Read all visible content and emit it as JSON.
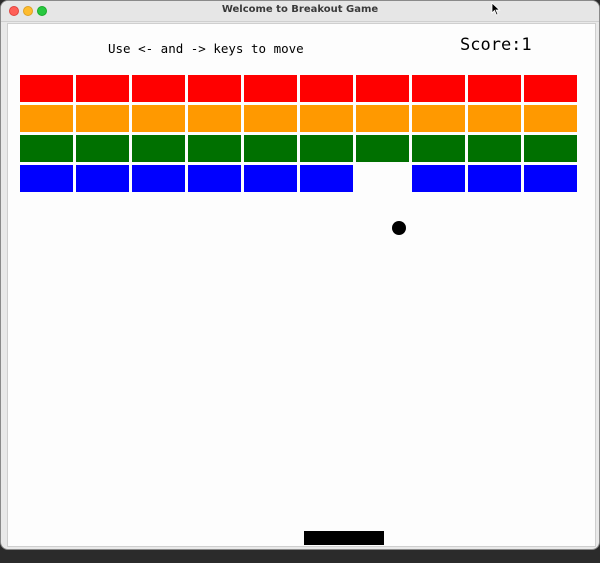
{
  "window": {
    "title": "Welcome to Breakout Game"
  },
  "hud": {
    "instructions": "Use <- and -> keys to move",
    "score_text": "Score:1",
    "score_value": 1
  },
  "bricks": {
    "columns": 10,
    "rows": [
      {
        "color": "#ff0000",
        "present": [
          true,
          true,
          true,
          true,
          true,
          true,
          true,
          true,
          true,
          true
        ]
      },
      {
        "color": "#ff9900",
        "present": [
          true,
          true,
          true,
          true,
          true,
          true,
          true,
          true,
          true,
          true
        ]
      },
      {
        "color": "#007000",
        "present": [
          true,
          true,
          true,
          true,
          true,
          true,
          true,
          true,
          true,
          true
        ]
      },
      {
        "color": "#0000ff",
        "present": [
          true,
          true,
          true,
          true,
          true,
          true,
          false,
          true,
          true,
          true
        ]
      }
    ]
  },
  "ball": {
    "color": "#000000"
  },
  "paddle": {
    "color": "#000000"
  },
  "icons": {
    "close": "close-button-icon",
    "minimize": "minimize-button-icon",
    "maximize": "maximize-button-icon",
    "cursor": "mouse-pointer-icon"
  }
}
